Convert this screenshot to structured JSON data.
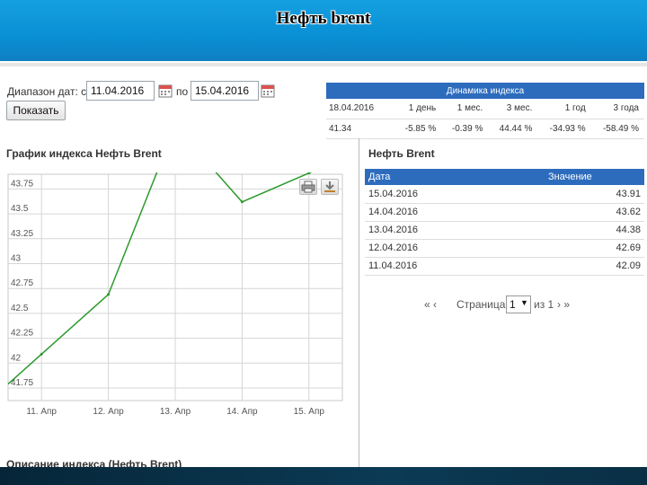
{
  "slide": {
    "title": "Нефть brent"
  },
  "filter": {
    "label": "Диапазон дат: с",
    "from": "11.04.2016",
    "to_label": "по",
    "to": "15.04.2016",
    "button": "Показать"
  },
  "dynamics": {
    "title": "Динамика индекса",
    "headers": [
      "18.04.2016",
      "1 день",
      "1 мес.",
      "3 мес.",
      "1 год",
      "3 года"
    ],
    "values": [
      "41.34",
      "-5.85 %",
      "-0.39 %",
      "44.44 %",
      "-34.93 %",
      "-58.49 %"
    ]
  },
  "chart": {
    "title": "График индекса Нефть Brent"
  },
  "chart_data": {
    "type": "line",
    "title": "График индекса Нефть Brent",
    "categories": [
      "11. Апр",
      "12. Апр",
      "13. Апр",
      "14. Апр",
      "15. Апр"
    ],
    "series": [
      {
        "values": [
          42.09,
          42.69,
          44.38,
          43.62,
          43.91
        ],
        "color": "#2b9a2b"
      }
    ],
    "yticks": [
      "44.25",
      "44",
      "43.75",
      "43.5",
      "43.25",
      "43",
      "42.75",
      "42.5",
      "42.25",
      "42",
      "41.75"
    ],
    "ylim": [
      41.75,
      44.25
    ],
    "grid": true
  },
  "table": {
    "title": "Нефть Brent",
    "headers": {
      "date": "Дата",
      "value": "Значение"
    },
    "rows": [
      {
        "date": "15.04.2016",
        "value": "43.91"
      },
      {
        "date": "14.04.2016",
        "value": "43.62"
      },
      {
        "date": "13.04.2016",
        "value": "44.38"
      },
      {
        "date": "12.04.2016",
        "value": "42.69"
      },
      {
        "date": "11.04.2016",
        "value": "42.09"
      }
    ]
  },
  "pager": {
    "first": "« ‹",
    "label": "Страница",
    "page": "1",
    "of": "из 1",
    "last": "› »"
  },
  "footer": {
    "caption": "Описание индекса (Нефть Brent)"
  },
  "colors": {
    "banner": "#0a8fd4",
    "header_blue": "#2d6cbd",
    "line": "#2b9a2b",
    "bottom_bar": "#0b3a55"
  }
}
